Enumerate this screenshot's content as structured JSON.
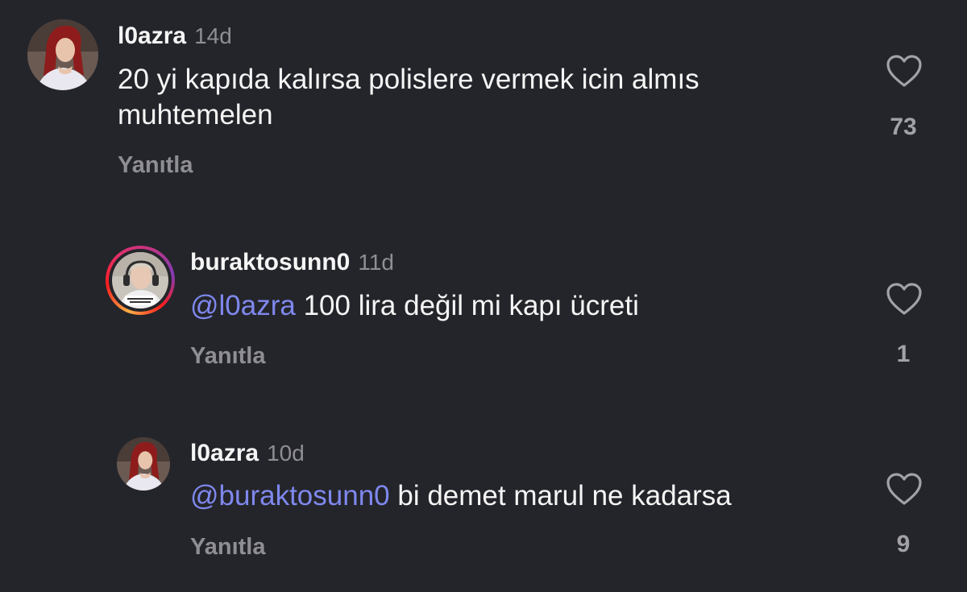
{
  "comments": [
    {
      "username": "l0azra",
      "time": "14d",
      "mention": "",
      "text": "20 yi kapıda kalırsa polislere vermek icin almıs muhtemelen",
      "reply_label": "Yanıtla",
      "like_count": "73",
      "avatar_icon": "profile-photo-icon"
    },
    {
      "username": "buraktosunn0",
      "time": "11d",
      "mention": "@l0azra",
      "text": "100 lira değil mi kapı ücreti",
      "reply_label": "Yanıtla",
      "like_count": "1",
      "avatar_icon": "profile-photo-icon",
      "story_ring": true
    },
    {
      "username": "l0azra",
      "time": "10d",
      "mention": "@buraktosunn0",
      "text": "bi demet marul ne kadarsa",
      "reply_label": "Yanıtla",
      "like_count": "9",
      "avatar_icon": "profile-photo-icon"
    }
  ],
  "colors": {
    "background": "#24252a",
    "mention": "#7f88ee",
    "muted": "#8e8e93",
    "story_ring": [
      "#fcb045",
      "#fd1d1d",
      "#c13584",
      "#833ab4"
    ]
  }
}
